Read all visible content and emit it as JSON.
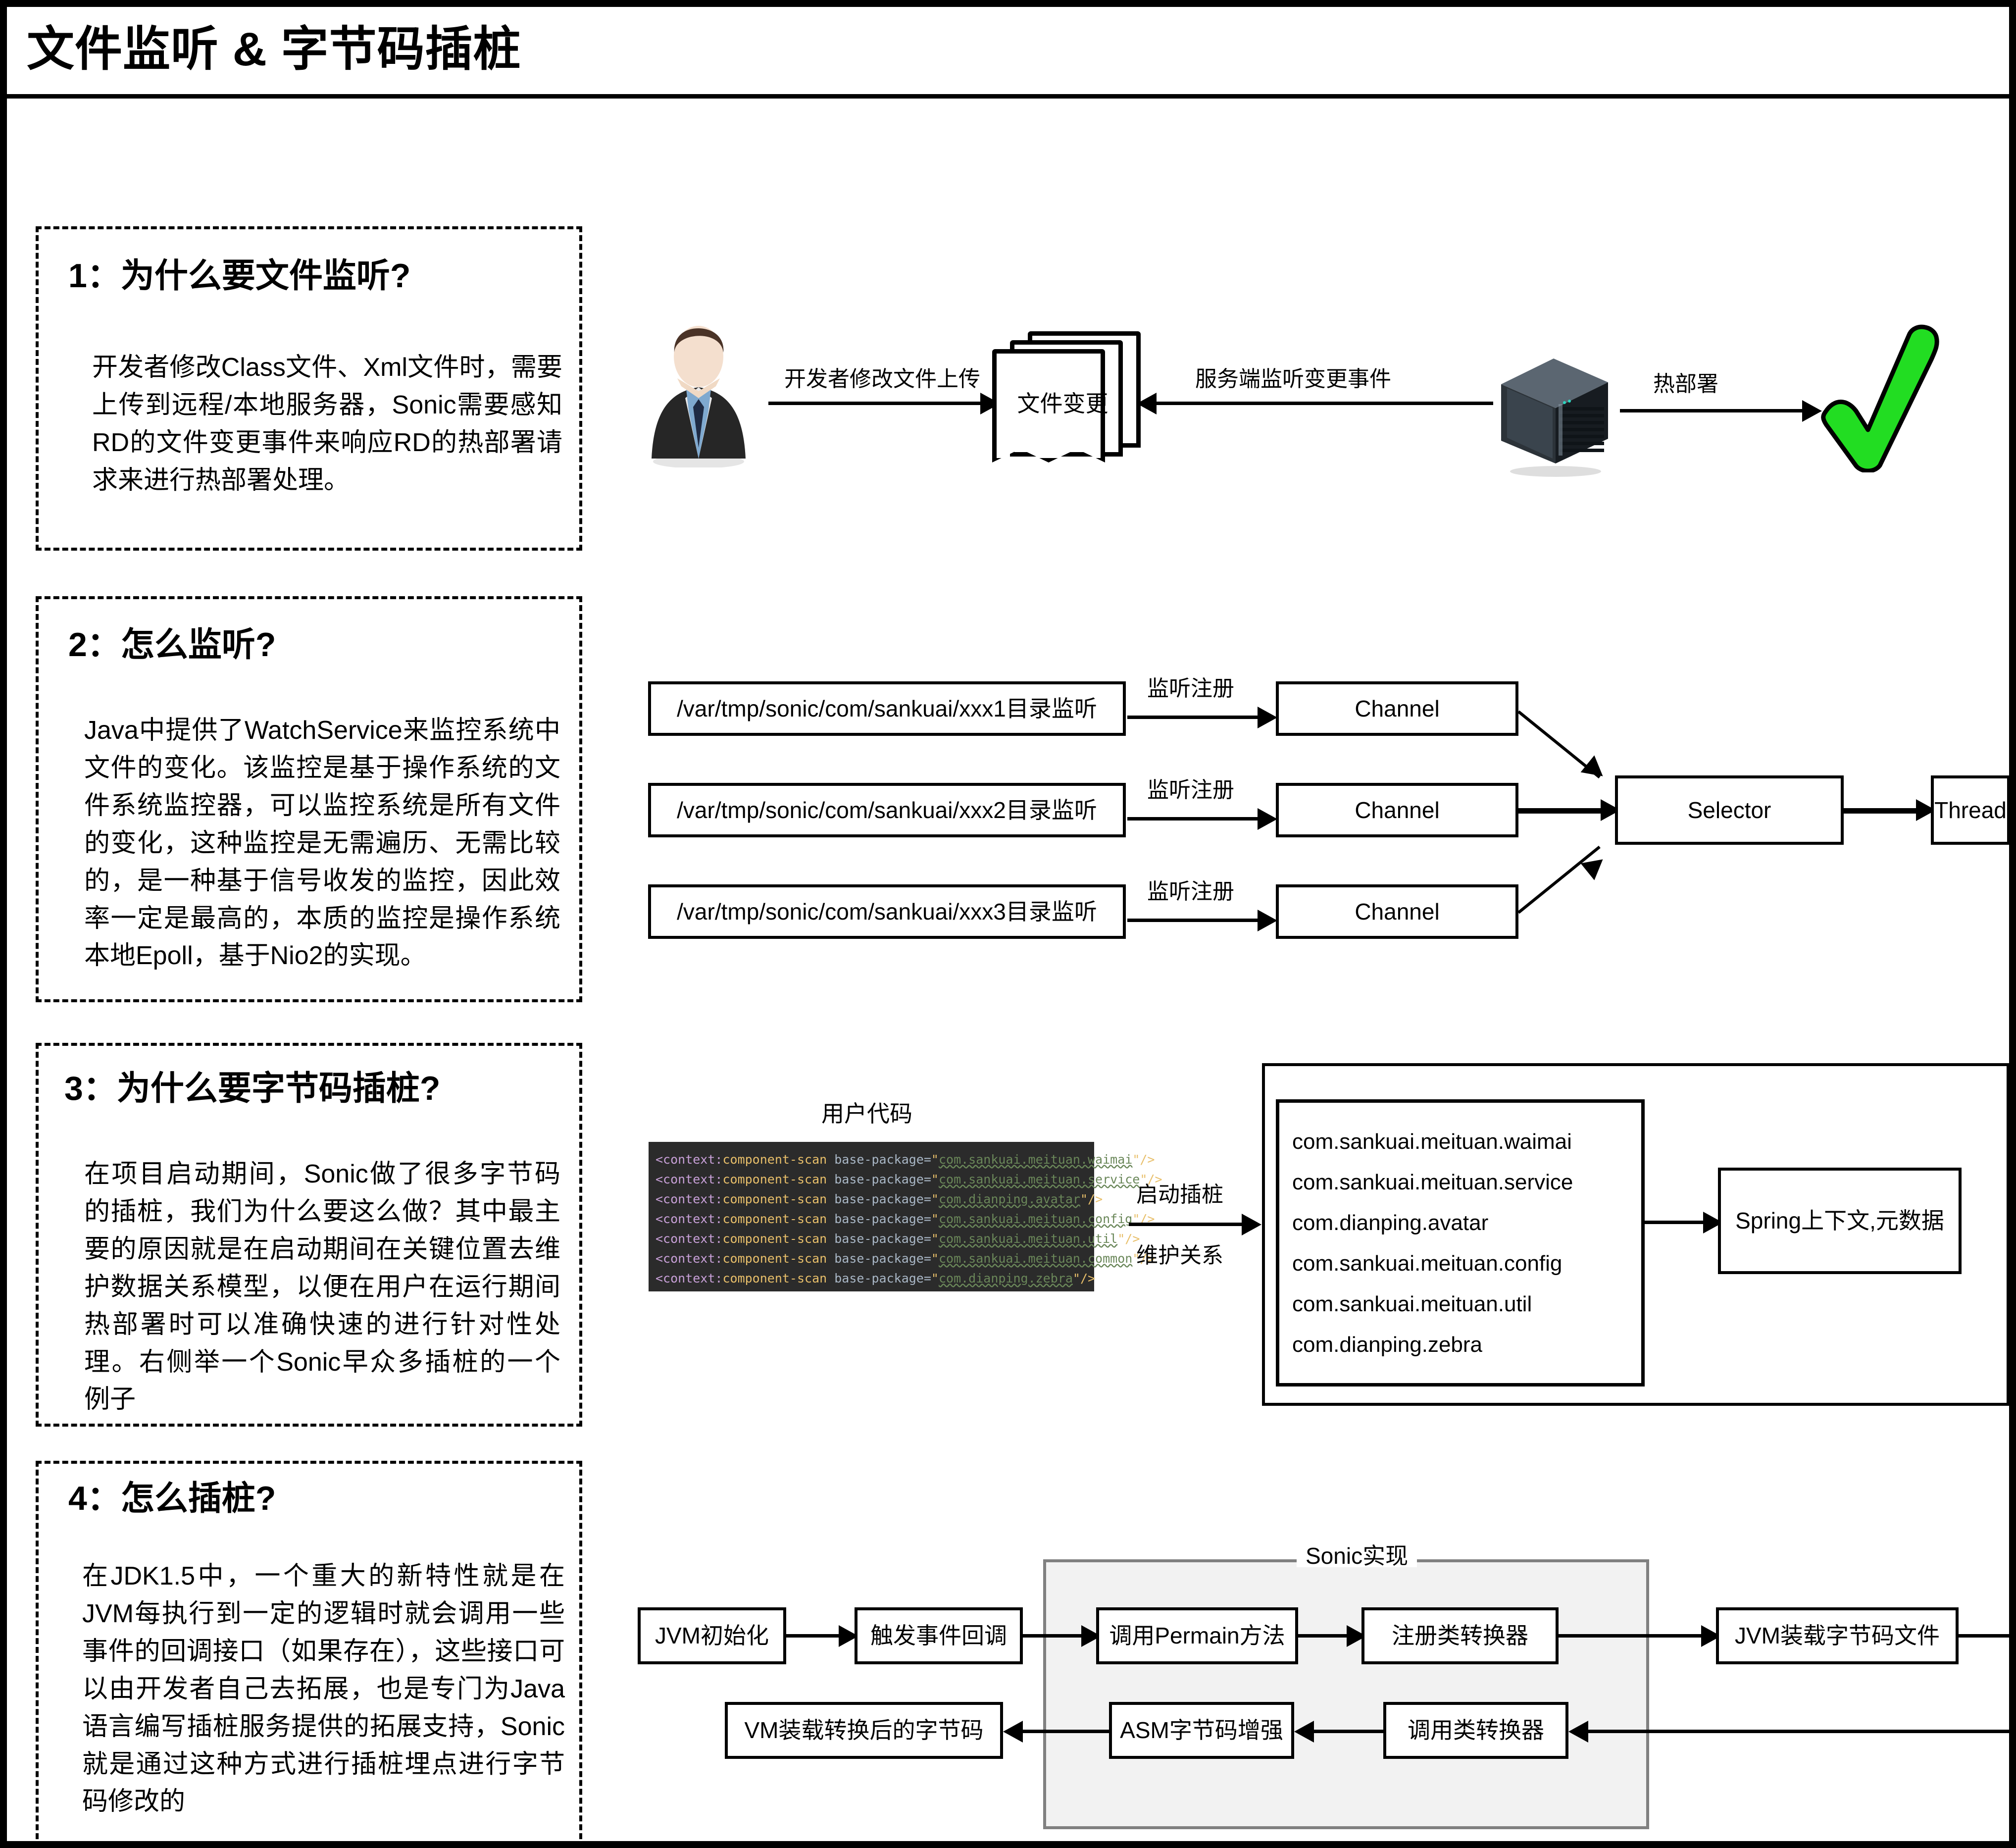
{
  "page": {
    "title": "文件监听 & 字节码插桩"
  },
  "sections": [
    {
      "heading": "1：为什么要文件监听?",
      "body": "开发者修改Class文件、Xml文件时，需要上传到远程/本地服务器，Sonic需要感知RD的文件变更事件来响应RD的热部署请求来进行热部署处理。",
      "diagram": {
        "actor_icon": "businessman-avatar-icon",
        "edge1_label": "开发者修改文件上传",
        "document_label": "文件变更",
        "document_icon": "document-stack-icon",
        "edge2_label": "服务端监听变更事件",
        "server_icon": "server-rack-icon",
        "edge3_label": "热部署",
        "result_icon": "green-check-icon",
        "result_color": "#22dd22"
      }
    },
    {
      "heading": "2：怎么监听?",
      "body": "Java中提供了WatchService来监控系统中文件的变化。该监控是基于操作系统的文件系统监控器，可以监控系统是所有文件的变化，这种监控是无需遍历、无需比较的，是一种基于信号收发的监控，因此效率一定是最高的，本质的监控是操作系统本地Epoll，基于Nio2的实现。",
      "diagram": {
        "watch_paths": [
          "/var/tmp/sonic/com/sankuai/xxx1目录监听",
          "/var/tmp/sonic/com/sankuai/xxx2目录监听",
          "/var/tmp/sonic/com/sankuai/xxx3目录监听"
        ],
        "register_labels": [
          "监听注册",
          "监听注册",
          "监听注册"
        ],
        "channels": [
          "Channel",
          "Channel",
          "Channel"
        ],
        "selector": "Selector",
        "thread": "Thread"
      }
    },
    {
      "heading": "3：为什么要字节码插桩?",
      "body": "在项目启动期间，Sonic做了很多字节码的插桩，我们为什么要这么做？其中最主要的原因就是在启动期间在关键位置去维护数据关系模型，以便在用户在运行期间热部署时可以准确快速的进行针对性处理。右侧举一个Sonic早众多插桩的一个例子",
      "diagram": {
        "code_caption": "用户代码",
        "code_lines": [
          {
            "tag": "<context:",
            "name": "component-scan",
            "attr": " base-package=",
            "quote_open": "\"",
            "pkg": "com.sankuai.meituan.waimai",
            "quote_close": "\"",
            "close": "/>"
          },
          {
            "tag": "<context:",
            "name": "component-scan",
            "attr": " base-package=",
            "quote_open": "\"",
            "pkg": "com.sankuai.meituan.service",
            "quote_close": "\"",
            "close": "/>"
          },
          {
            "tag": "<context:",
            "name": "component-scan",
            "attr": " base-package=",
            "quote_open": "\"",
            "pkg": "com.dianping.avatar",
            "quote_close": "\"",
            "close": "/>"
          },
          {
            "tag": "<context:",
            "name": "component-scan",
            "attr": " base-package=",
            "quote_open": "\"",
            "pkg": "com.sankuai.meituan.config",
            "quote_close": "\"",
            "close": "/>"
          },
          {
            "tag": "<context:",
            "name": "component-scan",
            "attr": " base-package=",
            "quote_open": "\"",
            "pkg": "com.sankuai.meituan.util",
            "quote_close": "\"",
            "close": "/>"
          },
          {
            "tag": "<context:",
            "name": "component-scan",
            "attr": " base-package=",
            "quote_open": "\"",
            "pkg": "com.sankuai.meituan.common",
            "quote_close": "\"",
            "close": "/>"
          },
          {
            "tag": "<context:",
            "name": "component-scan",
            "attr": " base-package=",
            "quote_open": "\"",
            "pkg": "com.dianping.zebra",
            "quote_close": "\"",
            "close": "/>"
          }
        ],
        "edge_label_top": "启动插桩",
        "edge_label_bottom": "维护关系",
        "packages": [
          "com.sankuai.meituan.waimai",
          "com.sankuai.meituan.service",
          "com.dianping.avatar",
          "com.sankuai.meituan.config",
          "com.sankuai.meituan.util",
          "com.dianping.zebra"
        ],
        "spring_box": "Spring上下文,元数据"
      }
    },
    {
      "heading": "4：怎么插桩?",
      "body": "在JDK1.5中，一个重大的新特性就是在JVM每执行到一定的逻辑时就会调用一些事件的回调接口（如果存在），这些接口可以由开发者自己去拓展，也是专门为Java语言编写插桩服务提供的拓展支持，Sonic就是通过这种方式进行插桩埋点进行字节码修改的",
      "diagram": {
        "group_label": "Sonic实现",
        "steps_top": [
          "JVM初始化",
          "触发事件回调",
          "调用Permain方法",
          "注册类转换器",
          "JVM装载字节码文件"
        ],
        "steps_bottom": [
          "VM装载转换后的字节码",
          "ASM字节码增强",
          "调用类转换器"
        ]
      }
    }
  ]
}
